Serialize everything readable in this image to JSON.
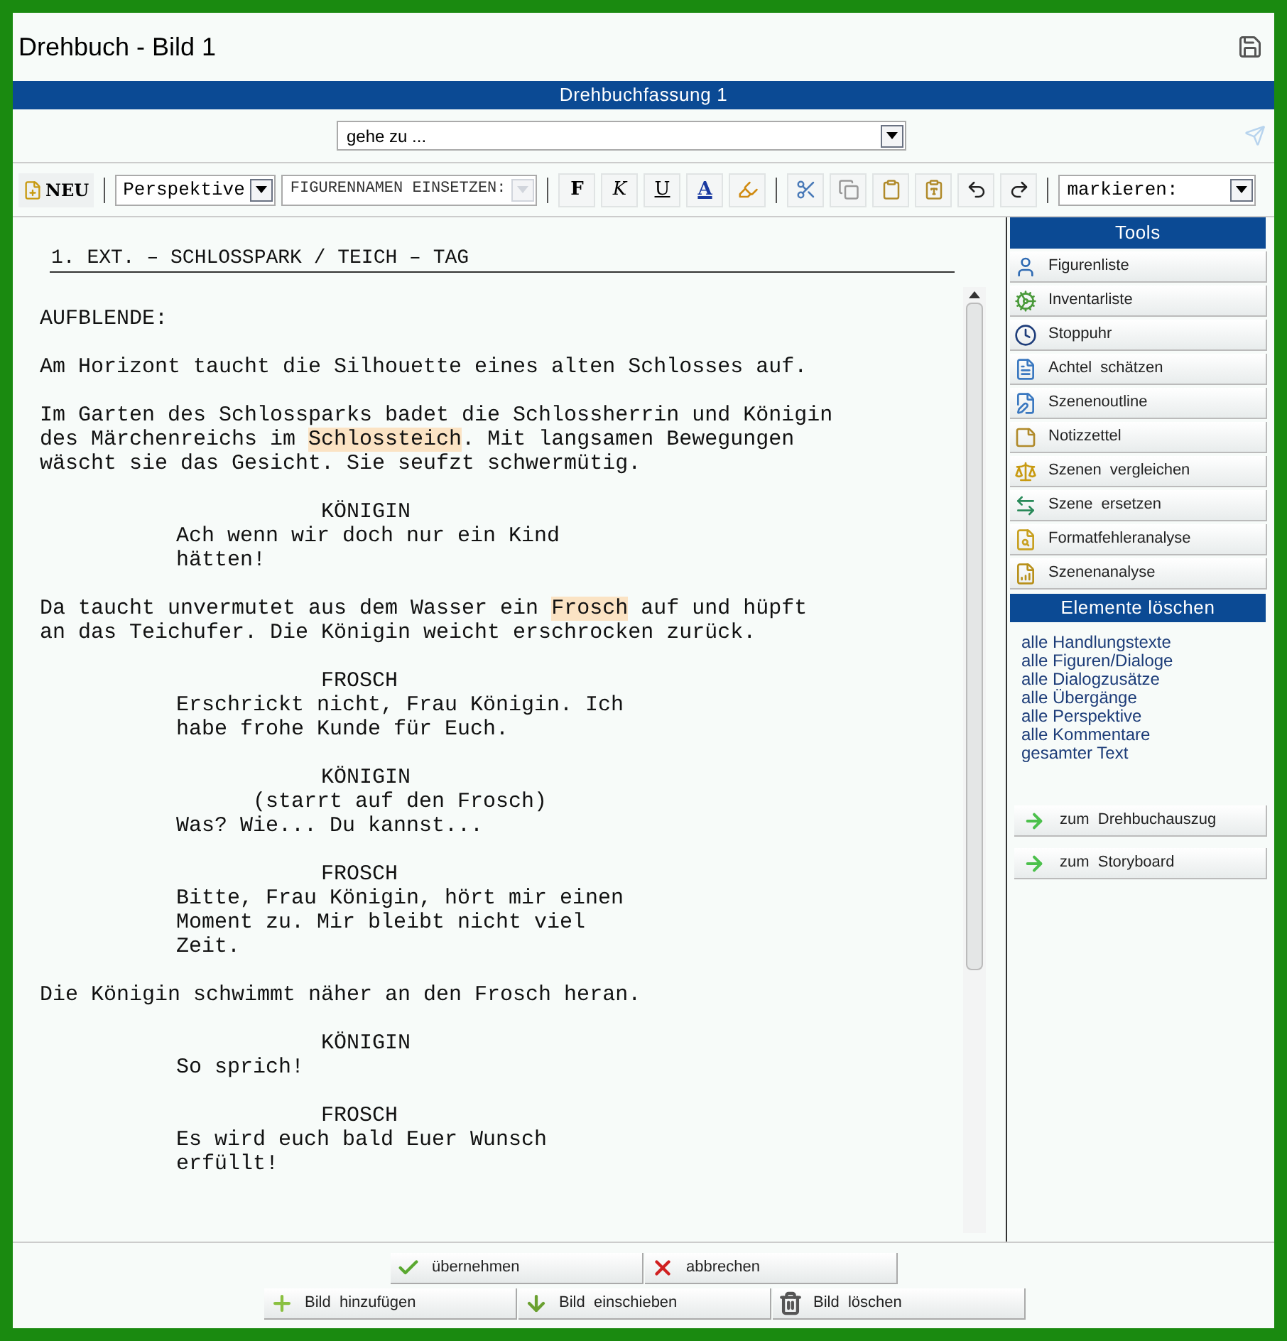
{
  "window": {
    "title": "Drehbuch - Bild 1"
  },
  "version_bar": {
    "title": "Drehbuchfassung 1"
  },
  "goto": {
    "value": "gehe zu ..."
  },
  "toolbar": {
    "new_button": "NEU",
    "selects": [
      {
        "value": "Perspektive",
        "disabled": false
      },
      {
        "value": "FIGURENNAMEN EINSETZEN:",
        "disabled": true
      }
    ],
    "format_buttons": [
      "F",
      "K",
      "U",
      "A"
    ],
    "mark_select": {
      "value": "markieren:"
    }
  },
  "editor": {
    "scene_heading": "1. EXT. – SCHLOSSPARK / TEICH – TAG",
    "blocks": [
      {
        "kind": "transition",
        "lines": [
          [
            {
              "text": "AUFBLENDE:",
              "highlight": false
            }
          ]
        ]
      },
      {
        "kind": "action",
        "lines": [
          [
            {
              "text": "Am Horizont taucht die Silhouette eines alten Schlosses auf.",
              "highlight": false
            }
          ]
        ]
      },
      {
        "kind": "action",
        "lines": [
          [
            {
              "text": "Im Garten des Schlossparks badet die Schlossherrin und Königin",
              "highlight": false
            }
          ],
          [
            {
              "text": "des Märchenreichs im ",
              "highlight": false
            },
            {
              "text": "Schlossteich",
              "highlight": true
            },
            {
              "text": ". Mit langsamen Bewegungen",
              "highlight": false
            }
          ],
          [
            {
              "text": "wäscht sie das Gesicht. Sie seufzt schwermütig.",
              "highlight": false
            }
          ]
        ]
      },
      {
        "kind": "character",
        "lines": [
          [
            {
              "text": "KÖNIGIN",
              "highlight": false
            }
          ]
        ]
      },
      {
        "kind": "dialogue",
        "lines": [
          [
            {
              "text": "Ach wenn wir doch nur ein Kind",
              "highlight": false
            }
          ],
          [
            {
              "text": "hätten!",
              "highlight": false
            }
          ]
        ]
      },
      {
        "kind": "action",
        "lines": [
          [
            {
              "text": "Da taucht unvermutet aus dem Wasser ein ",
              "highlight": false
            },
            {
              "text": "Frosch",
              "highlight": true
            },
            {
              "text": " auf und hüpft",
              "highlight": false
            }
          ],
          [
            {
              "text": "an das Teichufer. Die Königin weicht erschrocken zurück.",
              "highlight": false
            }
          ]
        ]
      },
      {
        "kind": "character",
        "lines": [
          [
            {
              "text": "FROSCH",
              "highlight": false
            }
          ]
        ]
      },
      {
        "kind": "dialogue",
        "lines": [
          [
            {
              "text": "Erschrickt nicht, Frau Königin. Ich",
              "highlight": false
            }
          ],
          [
            {
              "text": "habe frohe Kunde für Euch.",
              "highlight": false
            }
          ]
        ]
      },
      {
        "kind": "character",
        "lines": [
          [
            {
              "text": "KÖNIGIN",
              "highlight": false
            }
          ]
        ]
      },
      {
        "kind": "parenthetical",
        "lines": [
          [
            {
              "text": "(starrt auf den Frosch)",
              "highlight": false
            }
          ]
        ]
      },
      {
        "kind": "dialogue",
        "lines": [
          [
            {
              "text": "Was? Wie... Du kannst...",
              "highlight": false
            }
          ]
        ]
      },
      {
        "kind": "character",
        "lines": [
          [
            {
              "text": "FROSCH",
              "highlight": false
            }
          ]
        ]
      },
      {
        "kind": "dialogue",
        "lines": [
          [
            {
              "text": "Bitte, Frau Königin, hört mir einen",
              "highlight": false
            }
          ],
          [
            {
              "text": "Moment zu. Mir bleibt nicht viel",
              "highlight": false
            }
          ],
          [
            {
              "text": "Zeit.",
              "highlight": false
            }
          ]
        ]
      },
      {
        "kind": "action",
        "lines": [
          [
            {
              "text": "Die Königin schwimmt näher an den Frosch heran.",
              "highlight": false
            }
          ]
        ]
      },
      {
        "kind": "character",
        "lines": [
          [
            {
              "text": "KÖNIGIN",
              "highlight": false
            }
          ]
        ]
      },
      {
        "kind": "dialogue",
        "lines": [
          [
            {
              "text": "So sprich!",
              "highlight": false
            }
          ]
        ]
      },
      {
        "kind": "character",
        "lines": [
          [
            {
              "text": "FROSCH",
              "highlight": false
            }
          ]
        ]
      },
      {
        "kind": "dialogue",
        "lines": [
          [
            {
              "text": "Es wird euch bald Euer Wunsch",
              "highlight": false
            }
          ],
          [
            {
              "text": "erfüllt!",
              "highlight": false
            }
          ]
        ]
      }
    ]
  },
  "sidebar": {
    "tools_title": "Tools",
    "tools": [
      "Figurenliste",
      "Inventarliste",
      "Stoppuhr",
      "Achtel  schätzen",
      "Szenenoutline",
      "Notizzettel",
      "Szenen  vergleichen",
      "Szene  ersetzen",
      "Formatfehleranalyse",
      "Szenenanalyse"
    ],
    "delete_title": "Elemente löschen",
    "delete_links": [
      "alle Handlungstexte",
      "alle Figuren/Dialoge",
      "alle Dialogzusätze",
      "alle Übergänge",
      "alle Perspektive",
      "alle Kommentare",
      "gesamter Text"
    ],
    "nav_buttons": [
      "zum  Drehbuchauszug",
      "zum  Storyboard"
    ]
  },
  "footer": {
    "rows": [
      [
        "übernehmen",
        "abbrechen"
      ],
      [
        "Bild  hinzufügen",
        "Bild  einschieben",
        "Bild  löschen"
      ]
    ]
  }
}
